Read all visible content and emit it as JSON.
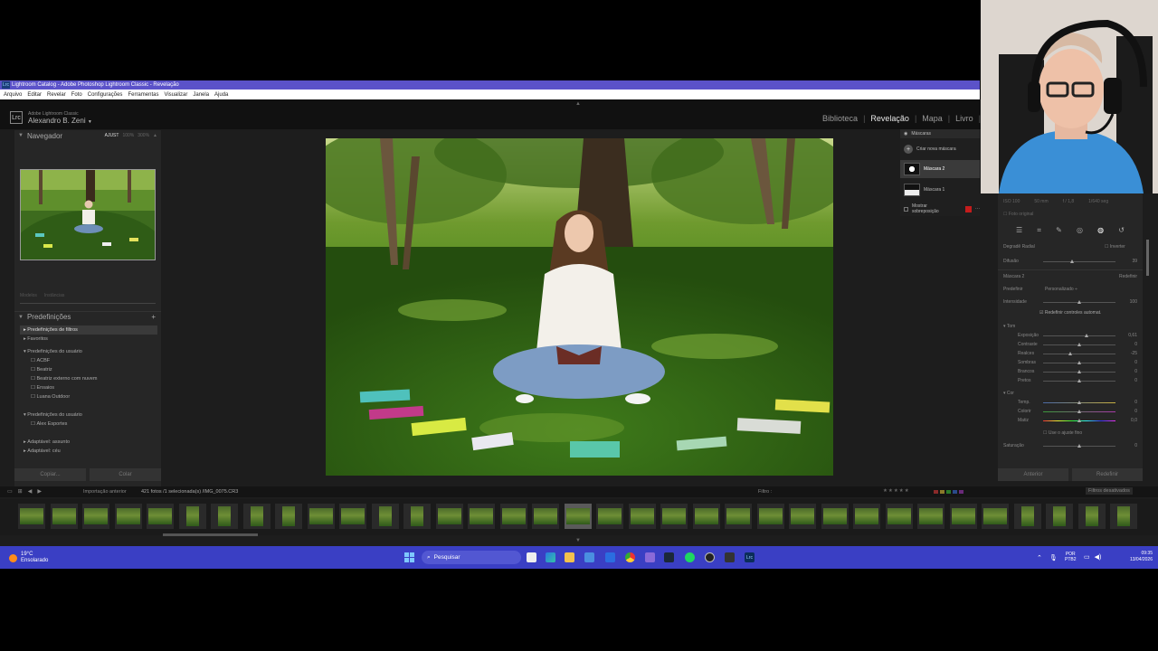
{
  "window": {
    "title": "Lightroom Catalog - Adobe Photoshop Lightroom Classic - Revelação",
    "app_icon": "Lrc"
  },
  "menu": [
    "Arquivo",
    "Editar",
    "Revelar",
    "Foto",
    "Configurações",
    "Ferramentas",
    "Visualizar",
    "Janela",
    "Ajuda"
  ],
  "identity": {
    "logo": "Lrc",
    "product": "Adobe Lightroom Classic",
    "user": "Alexandro B. Zeni",
    "user_arrow": "▼"
  },
  "modules": [
    "Biblioteca",
    "Revelação",
    "Mapa",
    "Livro"
  ],
  "left_panel": {
    "navigator_title": "Navegador",
    "zoom_options": [
      "AJUST",
      "100%",
      "300%",
      "▲"
    ],
    "snapshots_faded": [
      "Modelos",
      "Instâncias"
    ],
    "presets_title": "Predefinições",
    "presets_add": "+",
    "preset_items": [
      "Predefinições de filtros",
      "Favoritos",
      "Predefinições do usuário",
      "ACBF",
      "Beatriz",
      "Beatriz externo com nuvem",
      "Ensaios",
      "Luana Outdoor",
      "Predefinições do usuário",
      "Alex Esportes",
      "Adaptável: assunto",
      "Adaptável: céu"
    ],
    "copy_button": "Copiar...",
    "paste_button": "Colar"
  },
  "masks_panel": {
    "title": "Máscaras",
    "create_new": "Criar nova máscara",
    "mask_items": [
      "Máscara 2",
      "Máscara 1"
    ],
    "show_overlay": "Mostrar sobreposição",
    "overlay_color": "#c41c1c"
  },
  "right_panel": {
    "histogram_info": [
      "ISO 100",
      "50 mm",
      "f / 1,8",
      "1/640 seg"
    ],
    "original_photo": "Foto original",
    "tool_icons": [
      "sliders-icon",
      "crop-icon",
      "heal-icon",
      "redeye-icon",
      "mask-icon",
      "reset-icon"
    ],
    "radial_label": "Degradê Radial",
    "invert_label": "Inverter",
    "feather_label": "Difusão",
    "feather_value": "39",
    "mask_name": "Máscara 2",
    "mask_reset": "Redefinir",
    "preset_label": "Predefinir",
    "preset_value": "Personalizado ÷",
    "amount_label": "Intensidade",
    "amount_value": "100",
    "auto_reset": "Redefinir controles automat.",
    "tone_section": "Tom",
    "tone_sliders": [
      {
        "label": "Exposição",
        "value": "0,61",
        "level": 0.6
      },
      {
        "label": "Contraste",
        "value": "0",
        "level": 0.5
      },
      {
        "label": "Realces",
        "value": "-25",
        "level": 0.38
      },
      {
        "label": "Sombras",
        "value": "0",
        "level": 0.5
      },
      {
        "label": "Brancos",
        "value": "0",
        "level": 0.5
      },
      {
        "label": "Pretos",
        "value": "0",
        "level": 0.5
      }
    ],
    "color_section": "Cor",
    "color_sliders": [
      {
        "label": "Temp.",
        "value": "0",
        "level": 0.5
      },
      {
        "label": "Colorir",
        "value": "0",
        "level": 0.5
      },
      {
        "label": "Matiz",
        "value": "0,0",
        "level": 0.5
      }
    ],
    "fine_adjust": "Use o ajuste fino",
    "saturation_label": "Saturação",
    "saturation_value": "0",
    "previous_button": "Anterior",
    "reset_button": "Redefinir"
  },
  "filmstrip_bar": {
    "source": "Importação anterior",
    "count": "421 fotos /1 selecionada(s) /IMG_0075.CR3",
    "filter_label": "Filtro :",
    "filters_state": "Filtros desativados"
  },
  "taskbar": {
    "temperature": "19°C",
    "weather": "Ensolarado",
    "search_placeholder": "Pesquisar",
    "lang1": "POR",
    "lang2": "PTB2",
    "time": "09:35",
    "date": "13/04/2026"
  }
}
